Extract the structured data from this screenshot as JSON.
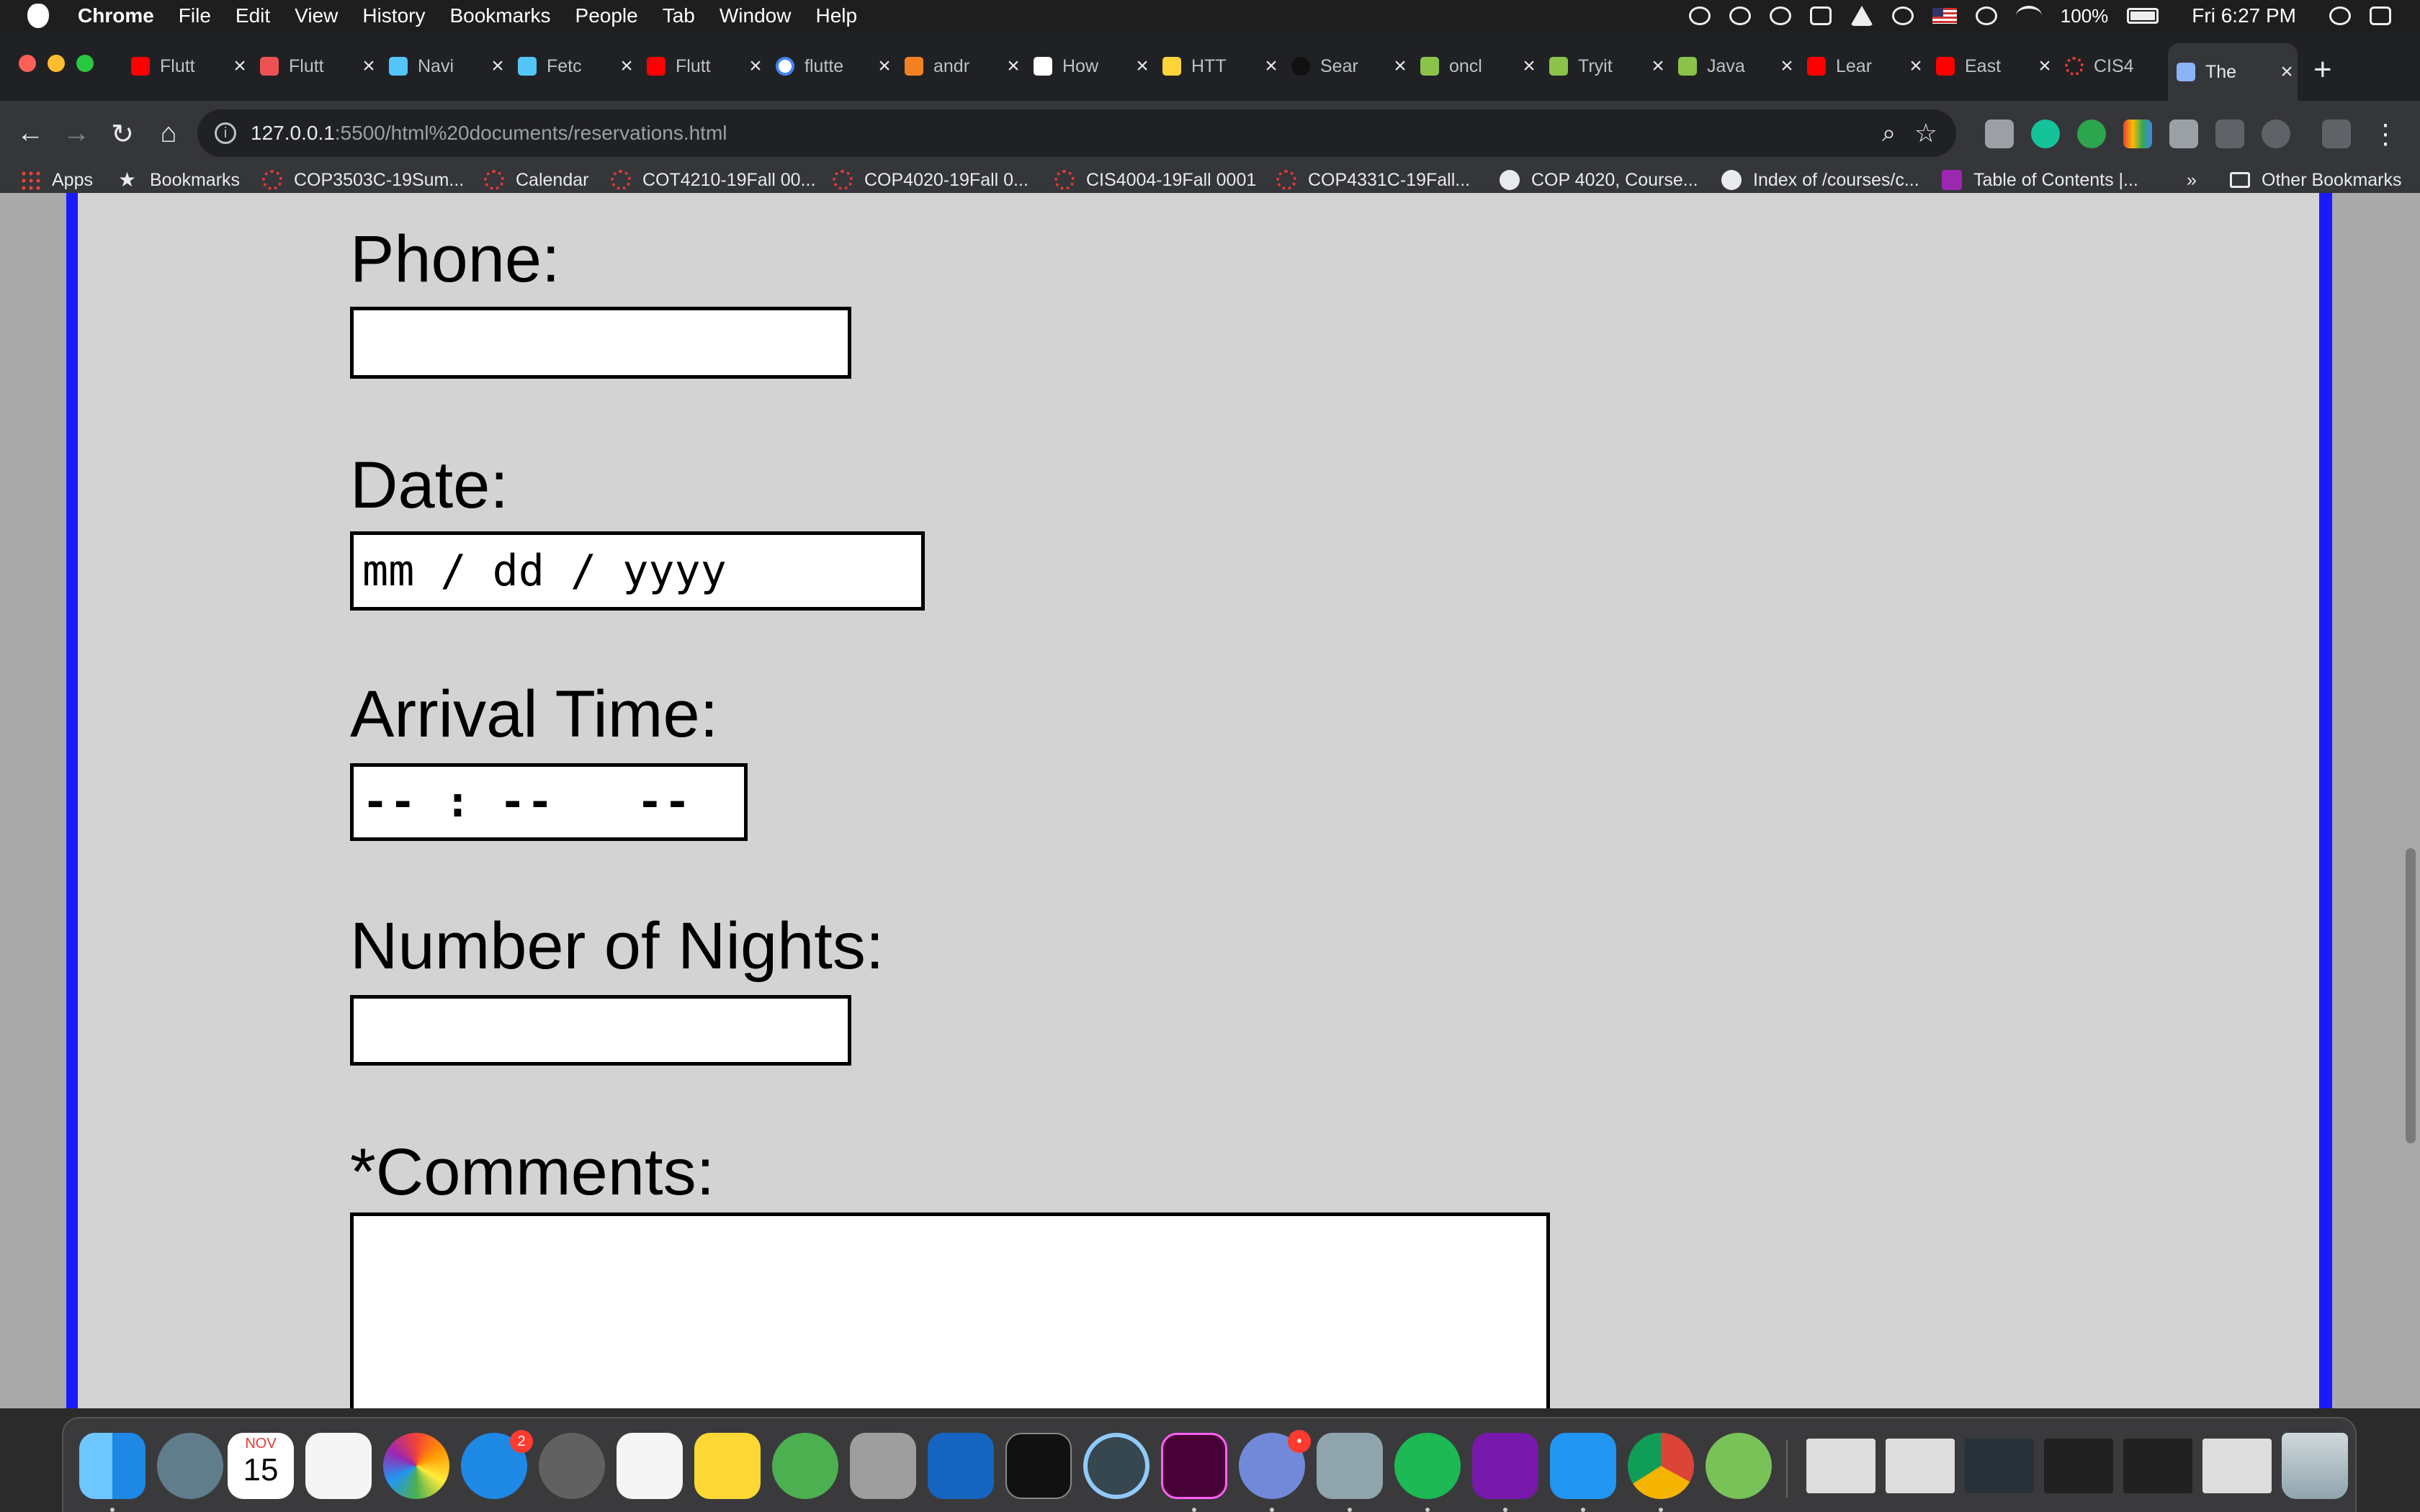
{
  "menubar": {
    "app": "Chrome",
    "items": [
      "File",
      "Edit",
      "View",
      "History",
      "Bookmarks",
      "People",
      "Tab",
      "Window",
      "Help"
    ],
    "battery": "100%",
    "clock": "Fri 6:27 PM"
  },
  "tabs": [
    {
      "title": "Flutt",
      "icon": "youtube-icon",
      "color": "#ff0000"
    },
    {
      "title": "Flutt",
      "icon": "udemy-icon",
      "color": "#ec5252"
    },
    {
      "title": "Navi",
      "icon": "flutter-icon",
      "color": "#54c5f8"
    },
    {
      "title": "Fetc",
      "icon": "flutter-icon",
      "color": "#54c5f8"
    },
    {
      "title": "Flutt",
      "icon": "youtube-icon",
      "color": "#ff0000"
    },
    {
      "title": "flutte",
      "icon": "google-icon",
      "color": "#4285f4"
    },
    {
      "title": "andr",
      "icon": "stackoverflow-icon",
      "color": "#f48024"
    },
    {
      "title": "How",
      "icon": "medium-icon",
      "color": "#ffffff"
    },
    {
      "title": "HTT",
      "icon": "python-icon",
      "color": "#ffd43b"
    },
    {
      "title": "Sear",
      "icon": "search-icon",
      "color": "#111111"
    },
    {
      "title": "oncl",
      "icon": "w3schools-icon",
      "color": "#8bc34a"
    },
    {
      "title": "Tryit",
      "icon": "w3schools-icon",
      "color": "#8bc34a"
    },
    {
      "title": "Java",
      "icon": "w3schools-icon",
      "color": "#8bc34a"
    },
    {
      "title": "Lear",
      "icon": "youtube-icon",
      "color": "#ff0000"
    },
    {
      "title": "East",
      "icon": "youtube-icon",
      "color": "#ff0000"
    },
    {
      "title": "CIS4",
      "icon": "canvas-icon",
      "color": "#e53935"
    },
    {
      "title": "The",
      "icon": "page-icon",
      "color": "#8ab4f8",
      "active": true
    }
  ],
  "toolbar": {
    "url_host": "127.0.0.1",
    "url_path": ":5500/html%20documents/reservations.html"
  },
  "bookmarks": [
    {
      "label": "Apps",
      "icon": "apps-grid-icon"
    },
    {
      "label": "Bookmarks",
      "icon": "star-icon"
    },
    {
      "label": "COP3503C-19Sum...",
      "icon": "canvas-icon"
    },
    {
      "label": "Calendar",
      "icon": "canvas-icon"
    },
    {
      "label": "COT4210-19Fall 00...",
      "icon": "canvas-icon"
    },
    {
      "label": "COP4020-19Fall 0...",
      "icon": "canvas-icon"
    },
    {
      "label": "CIS4004-19Fall 0001",
      "icon": "canvas-icon"
    },
    {
      "label": "COP4331C-19Fall...",
      "icon": "canvas-icon"
    },
    {
      "label": "COP 4020, Course...",
      "icon": "globe-icon"
    },
    {
      "label": "Index of /courses/c...",
      "icon": "globe-icon"
    },
    {
      "label": "Table of Contents |...",
      "icon": "book-icon"
    }
  ],
  "bookmarks_overflow": "»",
  "other_bookmarks": "Other Bookmarks",
  "form": {
    "phone_label": "Phone:",
    "date_label": "Date:",
    "date_placeholder": "mm / dd / yyyy",
    "time_label": "Arrival Time:",
    "time_placeholder": "-- : --   --",
    "nights_label": "Number of Nights:",
    "comments_label": "*Comments:"
  },
  "dock": {
    "calendar_month": "NOV",
    "calendar_day": "15",
    "appstore_badge": "2",
    "discord_badge": "•"
  }
}
